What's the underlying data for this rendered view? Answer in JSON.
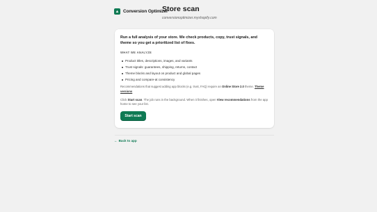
{
  "brand": {
    "name": "Conversion Optimizer",
    "logo_icon": "app-logo-icon",
    "accent_color": "#0f7a54"
  },
  "header": {
    "title": "Store scan",
    "store_domain": "conversionoptimizer.myshopify.com"
  },
  "card": {
    "intro": "Run a full analysis of your store. We check products, copy, trust signals, and theme so you get a prioritized list of fixes.",
    "section_title": "WHAT WE ANALYZE",
    "items": [
      "Product titles, descriptions, images, and variants",
      "Trust signals: guarantees, shipping, returns, contact",
      "Theme blocks and layout on product and global pages",
      "Pricing and compare-at consistency"
    ],
    "note_prefix": "Recommendations that suggest adding app blocks (e.g. trust, FAQ) require an ",
    "note_bold": "Online Store 2.0",
    "note_mid": " theme. ",
    "note_link": "Theme versions",
    "instr_prefix": "Click ",
    "instr_bold1": "Start scan",
    "instr_mid": ". The job runs in the background. When it finishes, open ",
    "instr_bold2": "View recommendations",
    "instr_suffix": " from the app home to see your list.",
    "start_button": "Start scan"
  },
  "back_link": {
    "arrow": "←",
    "label": "Back to app"
  }
}
